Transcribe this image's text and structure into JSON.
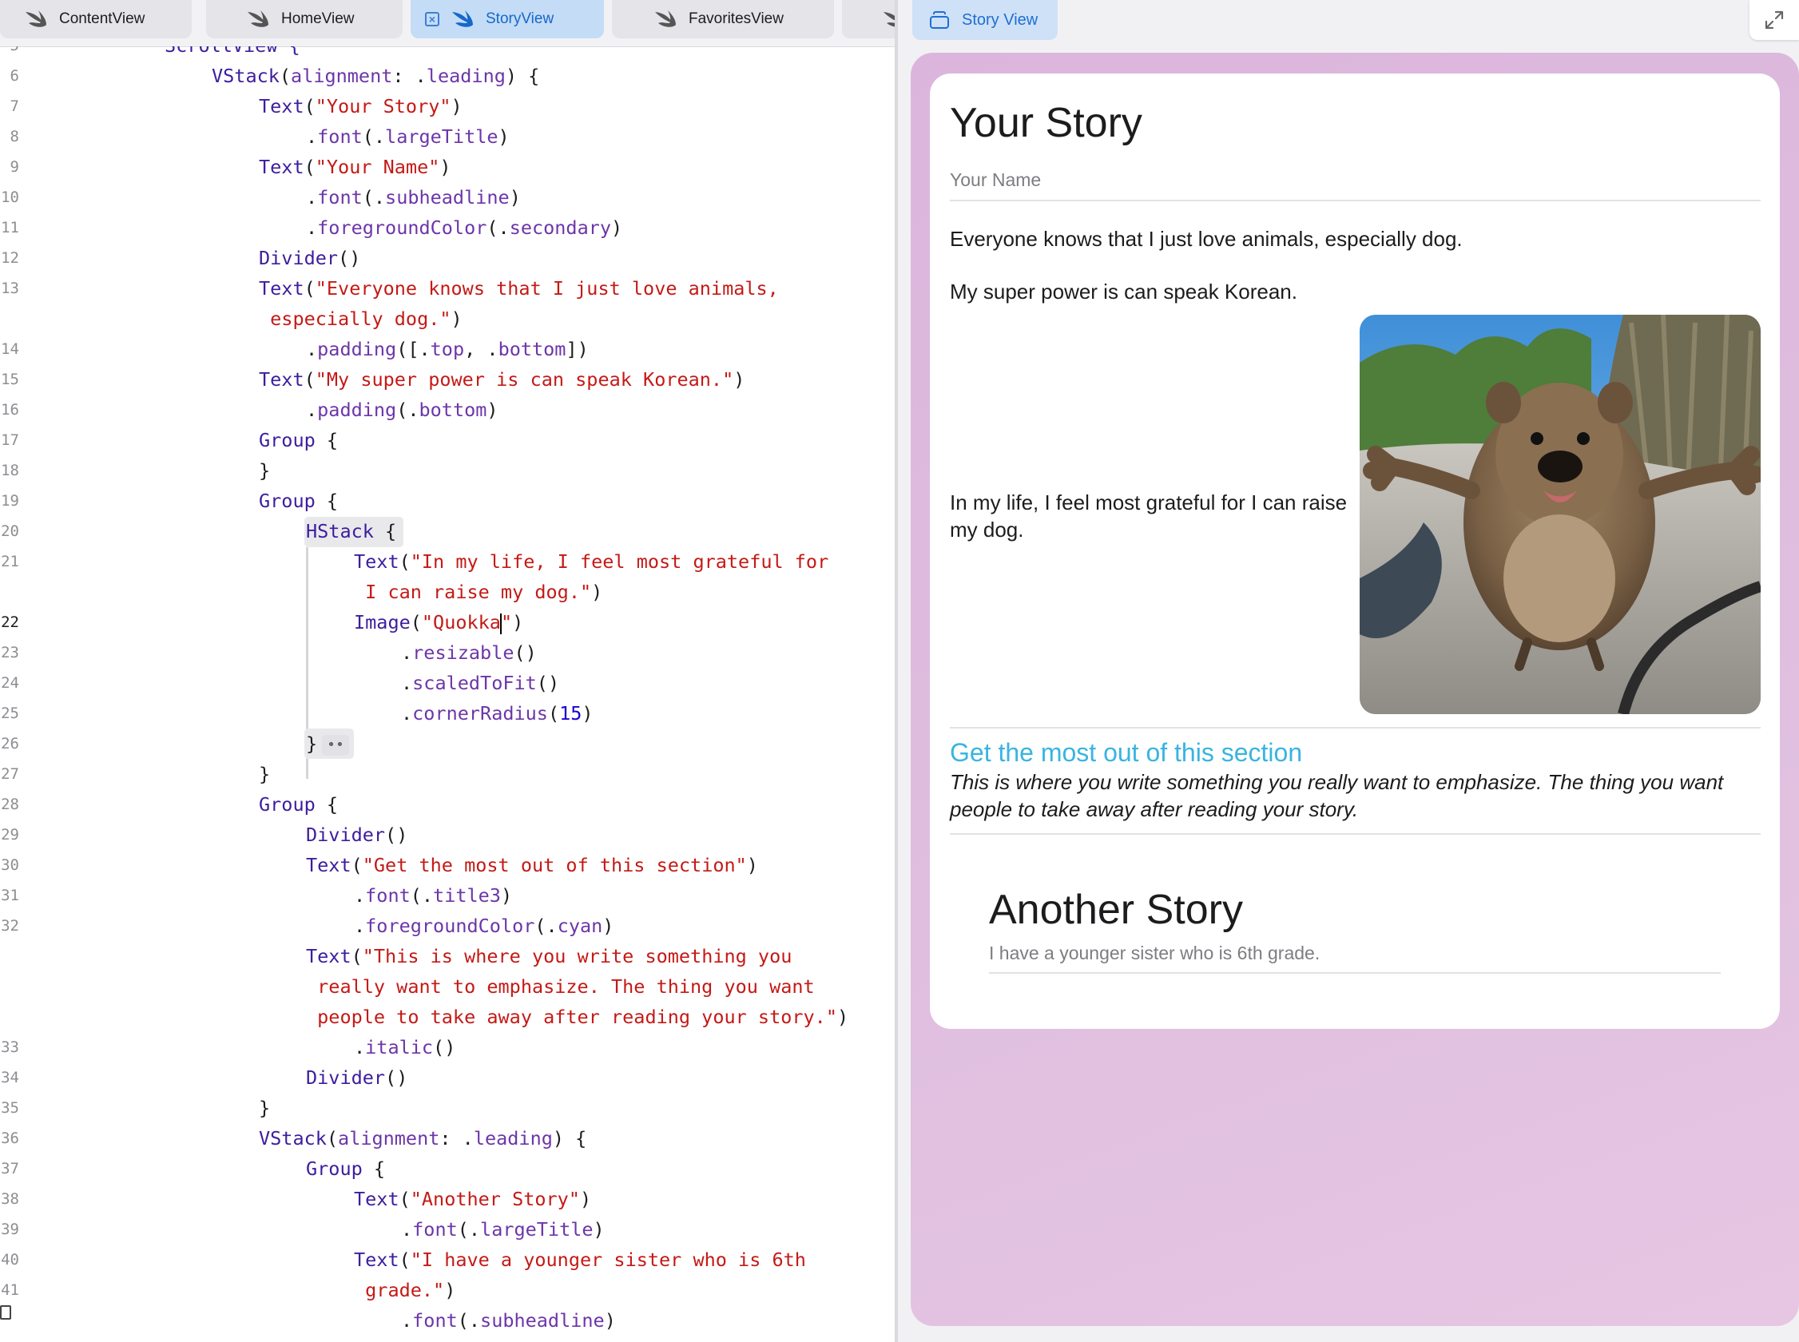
{
  "editor": {
    "tabs": [
      {
        "label": "ContentView",
        "active": false
      },
      {
        "label": "HomeView",
        "active": false
      },
      {
        "label": "StoryView",
        "active": true
      },
      {
        "label": "FavoritesView",
        "active": false
      }
    ],
    "line_numbers": [
      "5",
      "6",
      "7",
      "8",
      "9",
      "10",
      "11",
      "12",
      "13",
      "14",
      "15",
      "16",
      "17",
      "18",
      "19",
      "20",
      "21",
      "22",
      "23",
      "24",
      "25",
      "26",
      "27",
      "28",
      "29",
      "30",
      "31",
      "32",
      "33",
      "34",
      "35",
      "36",
      "37",
      "38",
      "39",
      "40",
      "41"
    ],
    "current_line": "22",
    "top_partial_line": "ScrollView {",
    "code": {
      "l6_a": "VStack",
      "l6_b": "(",
      "l6_c": "alignment",
      "l6_d": ": .",
      "l6_e": "leading",
      "l6_f": ") {",
      "l7_a": "Text",
      "l7_b": "(",
      "l7_c": "\"Your Story\"",
      "l7_d": ")",
      "l8_a": ".",
      "l8_b": "font",
      "l8_c": "(.",
      "l8_d": "largeTitle",
      "l8_e": ")",
      "l9_a": "Text",
      "l9_b": "(",
      "l9_c": "\"Your Name\"",
      "l9_d": ")",
      "l10_a": ".",
      "l10_b": "font",
      "l10_c": "(.",
      "l10_d": "subheadline",
      "l10_e": ")",
      "l11_a": ".",
      "l11_b": "foregroundColor",
      "l11_c": "(.",
      "l11_d": "secondary",
      "l11_e": ")",
      "l12_a": "Divider",
      "l12_b": "()",
      "l13_a": "Text",
      "l13_b": "(",
      "l13_c": "\"Everyone knows that I just love animals,",
      "l13w_a": " especially dog.\"",
      "l13w_b": ")",
      "l14_a": ".",
      "l14_b": "padding",
      "l14_c": "([.",
      "l14_d": "top",
      "l14_e": ", .",
      "l14_f": "bottom",
      "l14_g": "])",
      "l15_a": "Text",
      "l15_b": "(",
      "l15_c": "\"My super power is can speak Korean.\"",
      "l15_d": ")",
      "l16_a": ".",
      "l16_b": "padding",
      "l16_c": "(.",
      "l16_d": "bottom",
      "l16_e": ")",
      "l17_a": "Group",
      "l17_b": " {",
      "l18_a": "}",
      "l19_a": "Group",
      "l19_b": " {",
      "l20_a": "HStack",
      "l20_b": " {",
      "l21_a": "Text",
      "l21_b": "(",
      "l21_c": "\"In my life, I feel most grateful for",
      "l21w_a": " I can raise my dog.\"",
      "l21w_b": ")",
      "l22_a": "Image",
      "l22_b": "(",
      "l22_c": "\"Quokka",
      "l22_d": "\"",
      "l22_e": ")",
      "l23_a": ".",
      "l23_b": "resizable",
      "l23_c": "()",
      "l24_a": ".",
      "l24_b": "scaledToFit",
      "l24_c": "()",
      "l25_a": ".",
      "l25_b": "cornerRadius",
      "l25_c": "(",
      "l25_d": "15",
      "l25_e": ")",
      "l26_a": "}",
      "l26_fold": "••",
      "l27_a": "}",
      "l28_a": "Group",
      "l28_b": " {",
      "l29_a": "Divider",
      "l29_b": "()",
      "l30_a": "Text",
      "l30_b": "(",
      "l30_c": "\"Get the most out of this section\"",
      "l30_d": ")",
      "l31_a": ".",
      "l31_b": "font",
      "l31_c": "(.",
      "l31_d": "title3",
      "l31_e": ")",
      "l32_a": ".",
      "l32_b": "foregroundColor",
      "l32_c": "(.",
      "l32_d": "cyan",
      "l32_e": ")",
      "l33_a": "Text",
      "l33_b": "(",
      "l33_c": "\"This is where you write something you",
      "l33w1": " really want to emphasize. The thing you want",
      "l33w2_a": " people to take away after reading your story.\"",
      "l33w2_b": ")",
      "l34_a": ".",
      "l34_b": "italic",
      "l34_c": "()",
      "l35_a": "Divider",
      "l35_b": "()",
      "l36_a": "}",
      "l37_a": "VStack",
      "l37_b": "(",
      "l37_c": "alignment",
      "l37_d": ": .",
      "l37_e": "leading",
      "l37_f": ") {",
      "l38_a": "Group",
      "l38_b": " {",
      "l39_a": "Text",
      "l39_b": "(",
      "l39_c": "\"Another Story\"",
      "l39_d": ")",
      "l40_a": ".",
      "l40_b": "font",
      "l40_c": "(.",
      "l40_d": "largeTitle",
      "l40_e": ")",
      "l41_a": "Text",
      "l41_b": "(",
      "l41_c": "\"I have a younger sister who is 6th",
      "l41w_a": " grade.\"",
      "l41w_b": ")",
      "l42_a": ".",
      "l42_b": "font",
      "l42_c": "(.",
      "l42_d": "subheadline",
      "l42_e": ")"
    }
  },
  "preview": {
    "tab_label": "Story View",
    "expand_icon": "expand-arrows-icon",
    "title": "Your Story",
    "subtitle": "Your Name",
    "paragraph1": "Everyone knows that I just love animals, especially dog.",
    "paragraph2": "My super power is can speak Korean.",
    "hstack_text": "In my life, I feel most grateful for I can raise my dog.",
    "section_heading": "Get the most out of this section",
    "section_heading_color": "#39b4e0",
    "section_body": "This is where you write something you really want to emphasize. The thing you want people to take away after reading your story.",
    "another_title": "Another Story",
    "another_sub": "I have a younger sister who is 6th grade.",
    "background_color": "#dfbedf"
  }
}
